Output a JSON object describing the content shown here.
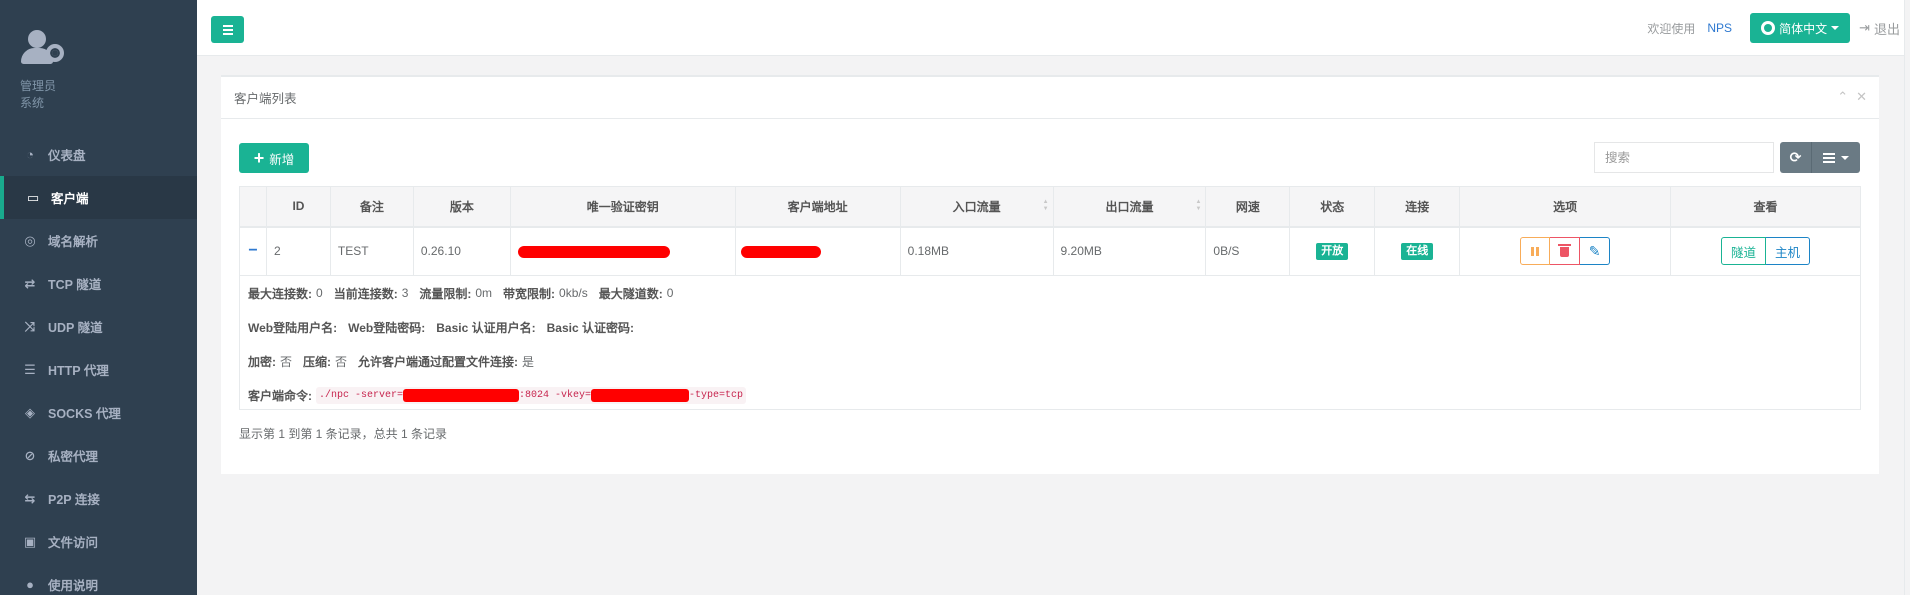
{
  "sidebar": {
    "role": "管理员",
    "system": "系统",
    "items": [
      {
        "label": "仪表盘",
        "icon": "dashboard-icon"
      },
      {
        "label": "客户端",
        "icon": "desktop-icon"
      },
      {
        "label": "域名解析",
        "icon": "globe-icon"
      },
      {
        "label": "TCP 隧道",
        "icon": "retweet-icon"
      },
      {
        "label": "UDP 隧道",
        "icon": "shuffle-icon"
      },
      {
        "label": "HTTP 代理",
        "icon": "server-icon"
      },
      {
        "label": "SOCKS 代理",
        "icon": "layers-icon"
      },
      {
        "label": "私密代理",
        "icon": "eye-slash-icon"
      },
      {
        "label": "P2P 连接",
        "icon": "exchange-icon"
      },
      {
        "label": "文件访问",
        "icon": "briefcase-icon"
      },
      {
        "label": "使用说明",
        "icon": "lightbulb-icon"
      }
    ],
    "active_index": 1
  },
  "header": {
    "welcome": "欢迎使用",
    "brand": "NPS",
    "language": "简体中文",
    "logout": "退出"
  },
  "panel": {
    "title": "客户端列表",
    "add_label": "新增",
    "search_placeholder": "搜索"
  },
  "table": {
    "columns": [
      "",
      "ID",
      "备注",
      "版本",
      "唯一验证密钥",
      "客户端地址",
      "入口流量",
      "出口流量",
      "网速",
      "状态",
      "连接",
      "选项",
      "查看"
    ],
    "rows": [
      {
        "id": "2",
        "remark": "TEST",
        "version": "0.26.10",
        "in_traffic": "0.18MB",
        "out_traffic": "9.20MB",
        "speed": "0B/S",
        "status": "开放",
        "connection": "在线",
        "view_tunnel": "隧道",
        "view_host": "主机"
      }
    ]
  },
  "detail": {
    "max_conn_label": "最大连接数:",
    "max_conn": "0",
    "cur_conn_label": "当前连接数:",
    "cur_conn": "3",
    "flow_limit_label": "流量限制:",
    "flow_limit": "0m",
    "rate_limit_label": "带宽限制:",
    "rate_limit": "0kb/s",
    "max_tunnel_label": "最大隧道数:",
    "max_tunnel": "0",
    "web_user_label": "Web登陆用户名:",
    "web_pass_label": "Web登陆密码:",
    "basic_user_label": "Basic 认证用户名:",
    "basic_pass_label": "Basic 认证密码:",
    "encrypt_label": "加密:",
    "encrypt": "否",
    "compress_label": "压缩:",
    "compress": "否",
    "config_conn_label": "允许客户端通过配置文件连接:",
    "config_conn": "是",
    "cmd_label": "客户端命令:",
    "cmd_prefix": "./npc -server=",
    "cmd_port": ":8024 -vkey=",
    "cmd_suffix": " -type=tcp"
  },
  "footer": {
    "info": "显示第 1 到第 1 条记录，总共 1 条记录"
  },
  "colors": {
    "sidebar": "#2f4050",
    "accent": "#1ab394",
    "redaction": "#ff0000"
  }
}
